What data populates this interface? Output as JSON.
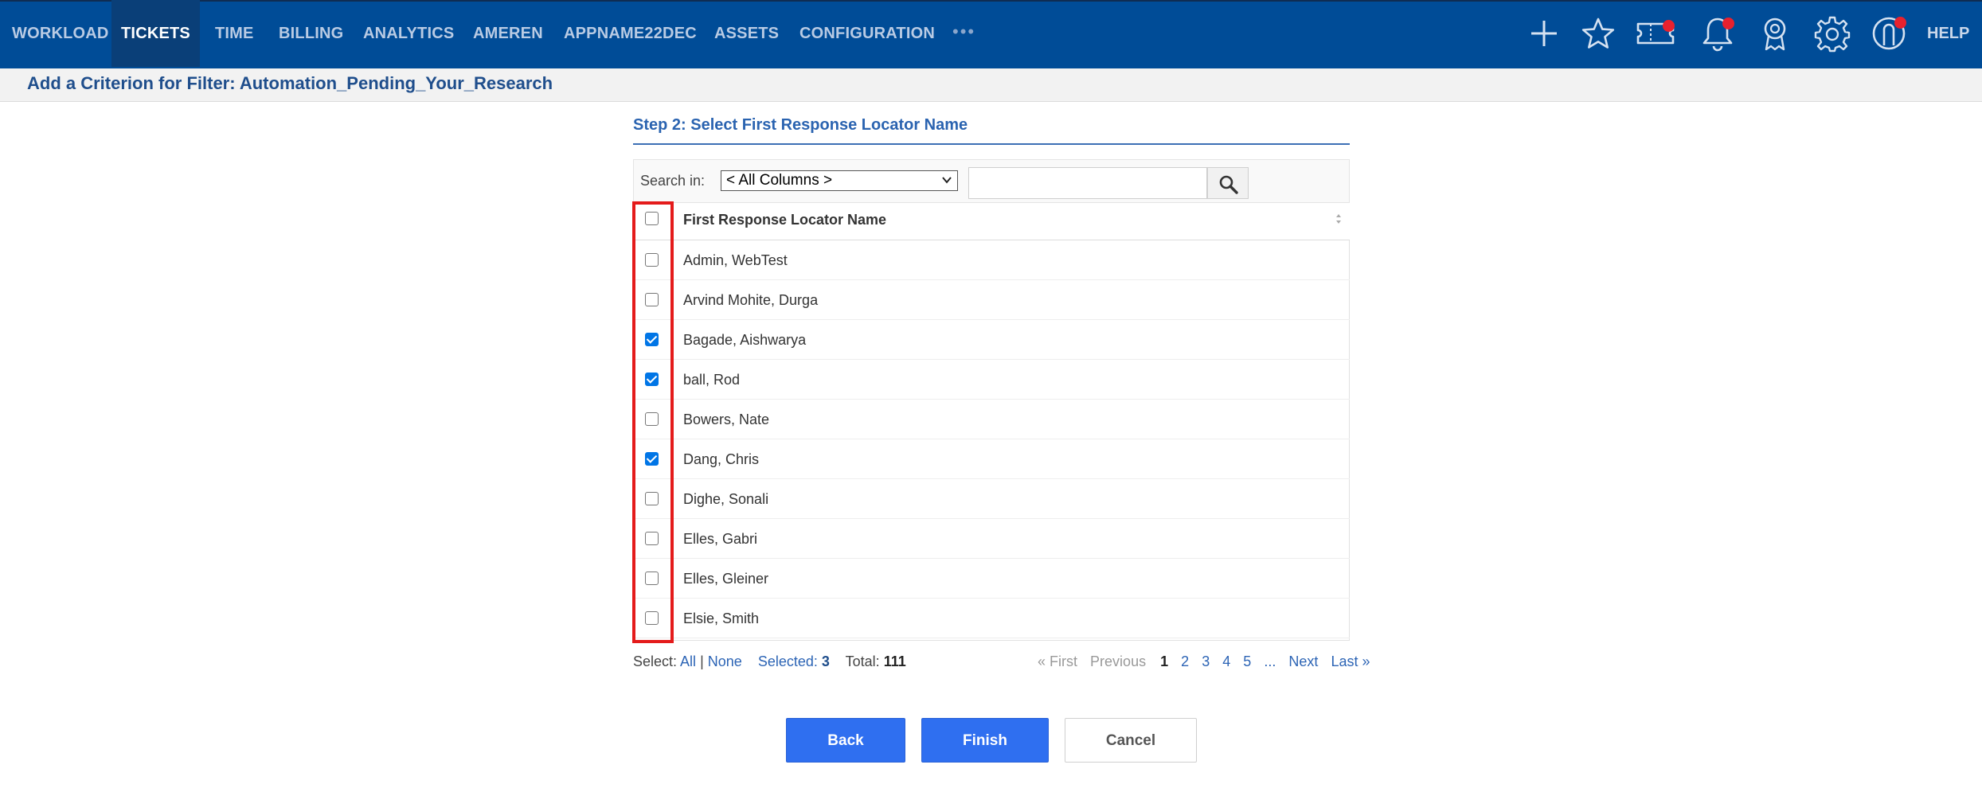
{
  "nav": {
    "items": [
      "WORKLOAD",
      "TICKETS",
      "TIME",
      "BILLING",
      "ANALYTICS",
      "AMEREN",
      "APPNAME22DEC",
      "ASSETS",
      "CONFIGURATION"
    ],
    "more": "•••",
    "icons": [
      "plus-icon",
      "star-icon",
      "ticket-icon",
      "bell-icon",
      "award-icon",
      "gear-icon",
      "user-icon"
    ],
    "help": "HELP",
    "accent": "#004c97",
    "badge_color": "#e8212e"
  },
  "page": {
    "title": "Add a Criterion for Filter: Automation_Pending_Your_Research"
  },
  "step": {
    "title": "Step 2: Select First Response Locator Name",
    "search_label": "Search in:",
    "search_scope": "< All Columns >",
    "search_value": "",
    "column_header": "First Response Locator Name",
    "rows": [
      {
        "name": "Admin, WebTest",
        "checked": false
      },
      {
        "name": "Arvind Mohite, Durga",
        "checked": false
      },
      {
        "name": "Bagade, Aishwarya",
        "checked": true
      },
      {
        "name": "ball, Rod",
        "checked": true
      },
      {
        "name": "Bowers, Nate",
        "checked": false
      },
      {
        "name": "Dang, Chris",
        "checked": true
      },
      {
        "name": "Dighe, Sonali",
        "checked": false
      },
      {
        "name": "Elles, Gabri",
        "checked": false
      },
      {
        "name": "Elles, Gleiner",
        "checked": false
      },
      {
        "name": "Elsie, Smith",
        "checked": false
      }
    ]
  },
  "selection": {
    "select_label": "Select:",
    "all": "All",
    "separator": "|",
    "none": "None",
    "selected_label": "Selected:",
    "selected_count": "3",
    "total_label": "Total:",
    "total_count": "111"
  },
  "pagination": {
    "first": "« First",
    "previous": "Previous",
    "current": "1",
    "pages": [
      "2",
      "3",
      "4",
      "5"
    ],
    "ellipsis": "...",
    "next": "Next",
    "last": "Last »"
  },
  "buttons": {
    "back": "Back",
    "finish": "Finish",
    "cancel": "Cancel"
  }
}
